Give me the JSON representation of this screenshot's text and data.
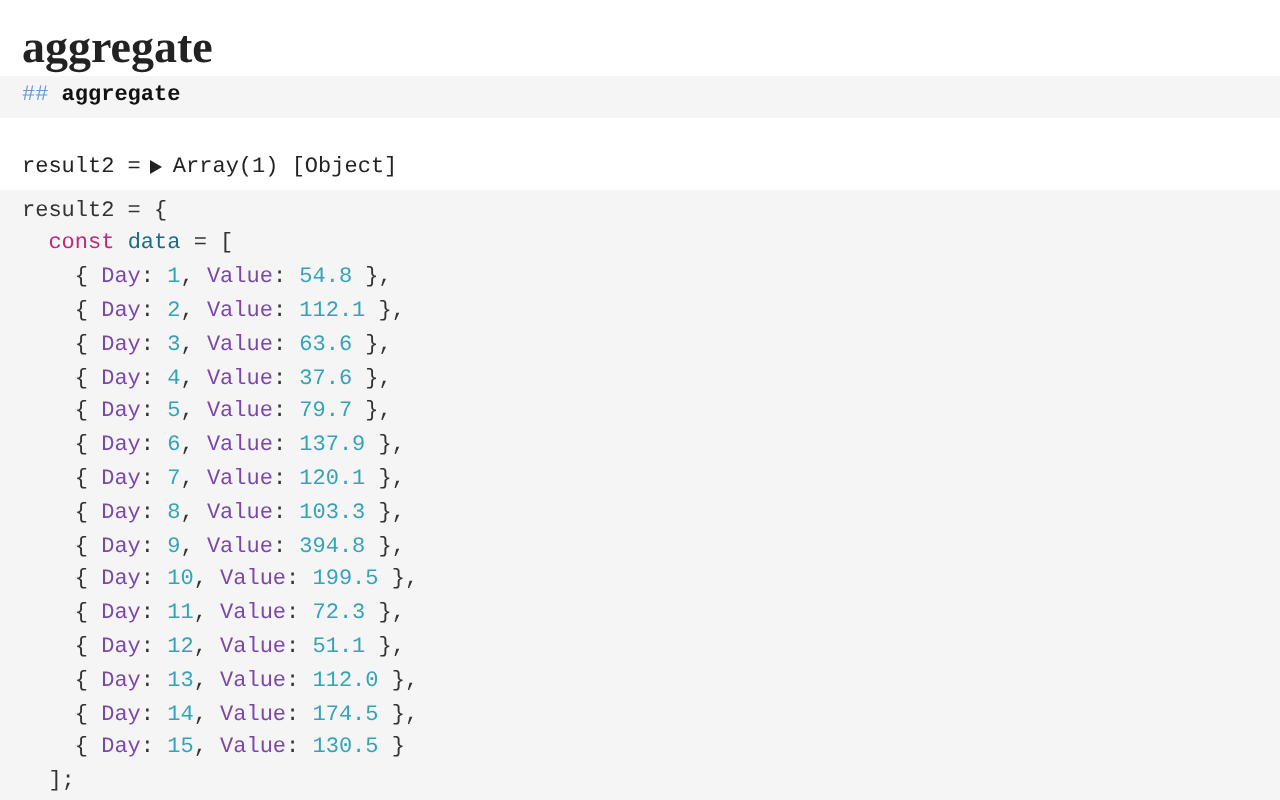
{
  "title": "aggregate",
  "markdown_cell": {
    "marker": "##",
    "text": "aggregate"
  },
  "output": {
    "name": "result2 =",
    "expanded": false,
    "value": "Array(1) [Object]"
  },
  "code": [
    [
      {
        "kind": "plain",
        "text": "result2 = {"
      }
    ],
    [
      {
        "kind": "keyword",
        "text": "  const"
      },
      {
        "kind": "variable",
        "text": " data"
      },
      {
        "kind": "plain",
        "text": " = ["
      }
    ],
    [
      {
        "kind": "plain",
        "text": "    { "
      },
      {
        "kind": "property",
        "text": "Day"
      },
      {
        "kind": "plain",
        "text": ": "
      },
      {
        "kind": "number",
        "text": "1"
      },
      {
        "kind": "plain",
        "text": ", "
      },
      {
        "kind": "property",
        "text": "Value"
      },
      {
        "kind": "plain",
        "text": ": "
      },
      {
        "kind": "number",
        "text": "54.8"
      },
      {
        "kind": "plain",
        "text": " },"
      }
    ],
    [
      {
        "kind": "plain",
        "text": "    { "
      },
      {
        "kind": "property",
        "text": "Day"
      },
      {
        "kind": "plain",
        "text": ": "
      },
      {
        "kind": "number",
        "text": "2"
      },
      {
        "kind": "plain",
        "text": ", "
      },
      {
        "kind": "property",
        "text": "Value"
      },
      {
        "kind": "plain",
        "text": ": "
      },
      {
        "kind": "number",
        "text": "112.1"
      },
      {
        "kind": "plain",
        "text": " },"
      }
    ],
    [
      {
        "kind": "plain",
        "text": "    { "
      },
      {
        "kind": "property",
        "text": "Day"
      },
      {
        "kind": "plain",
        "text": ": "
      },
      {
        "kind": "number",
        "text": "3"
      },
      {
        "kind": "plain",
        "text": ", "
      },
      {
        "kind": "property",
        "text": "Value"
      },
      {
        "kind": "plain",
        "text": ": "
      },
      {
        "kind": "number",
        "text": "63.6"
      },
      {
        "kind": "plain",
        "text": " },"
      }
    ],
    [
      {
        "kind": "plain",
        "text": "    { "
      },
      {
        "kind": "property",
        "text": "Day"
      },
      {
        "kind": "plain",
        "text": ": "
      },
      {
        "kind": "number",
        "text": "4"
      },
      {
        "kind": "plain",
        "text": ", "
      },
      {
        "kind": "property",
        "text": "Value"
      },
      {
        "kind": "plain",
        "text": ": "
      },
      {
        "kind": "number",
        "text": "37.6"
      },
      {
        "kind": "plain",
        "text": " },"
      }
    ],
    [
      {
        "kind": "plain",
        "text": "    { "
      },
      {
        "kind": "property",
        "text": "Day"
      },
      {
        "kind": "plain",
        "text": ": "
      },
      {
        "kind": "number",
        "text": "5"
      },
      {
        "kind": "plain",
        "text": ", "
      },
      {
        "kind": "property",
        "text": "Value"
      },
      {
        "kind": "plain",
        "text": ": "
      },
      {
        "kind": "number",
        "text": "79.7"
      },
      {
        "kind": "plain",
        "text": " },"
      }
    ],
    [
      {
        "kind": "plain",
        "text": "    { "
      },
      {
        "kind": "property",
        "text": "Day"
      },
      {
        "kind": "plain",
        "text": ": "
      },
      {
        "kind": "number",
        "text": "6"
      },
      {
        "kind": "plain",
        "text": ", "
      },
      {
        "kind": "property",
        "text": "Value"
      },
      {
        "kind": "plain",
        "text": ": "
      },
      {
        "kind": "number",
        "text": "137.9"
      },
      {
        "kind": "plain",
        "text": " },"
      }
    ],
    [
      {
        "kind": "plain",
        "text": "    { "
      },
      {
        "kind": "property",
        "text": "Day"
      },
      {
        "kind": "plain",
        "text": ": "
      },
      {
        "kind": "number",
        "text": "7"
      },
      {
        "kind": "plain",
        "text": ", "
      },
      {
        "kind": "property",
        "text": "Value"
      },
      {
        "kind": "plain",
        "text": ": "
      },
      {
        "kind": "number",
        "text": "120.1"
      },
      {
        "kind": "plain",
        "text": " },"
      }
    ],
    [
      {
        "kind": "plain",
        "text": "    { "
      },
      {
        "kind": "property",
        "text": "Day"
      },
      {
        "kind": "plain",
        "text": ": "
      },
      {
        "kind": "number",
        "text": "8"
      },
      {
        "kind": "plain",
        "text": ", "
      },
      {
        "kind": "property",
        "text": "Value"
      },
      {
        "kind": "plain",
        "text": ": "
      },
      {
        "kind": "number",
        "text": "103.3"
      },
      {
        "kind": "plain",
        "text": " },"
      }
    ],
    [
      {
        "kind": "plain",
        "text": "    { "
      },
      {
        "kind": "property",
        "text": "Day"
      },
      {
        "kind": "plain",
        "text": ": "
      },
      {
        "kind": "number",
        "text": "9"
      },
      {
        "kind": "plain",
        "text": ", "
      },
      {
        "kind": "property",
        "text": "Value"
      },
      {
        "kind": "plain",
        "text": ": "
      },
      {
        "kind": "number",
        "text": "394.8"
      },
      {
        "kind": "plain",
        "text": " },"
      }
    ],
    [
      {
        "kind": "plain",
        "text": "    { "
      },
      {
        "kind": "property",
        "text": "Day"
      },
      {
        "kind": "plain",
        "text": ": "
      },
      {
        "kind": "number",
        "text": "10"
      },
      {
        "kind": "plain",
        "text": ", "
      },
      {
        "kind": "property",
        "text": "Value"
      },
      {
        "kind": "plain",
        "text": ": "
      },
      {
        "kind": "number",
        "text": "199.5"
      },
      {
        "kind": "plain",
        "text": " },"
      }
    ],
    [
      {
        "kind": "plain",
        "text": "    { "
      },
      {
        "kind": "property",
        "text": "Day"
      },
      {
        "kind": "plain",
        "text": ": "
      },
      {
        "kind": "number",
        "text": "11"
      },
      {
        "kind": "plain",
        "text": ", "
      },
      {
        "kind": "property",
        "text": "Value"
      },
      {
        "kind": "plain",
        "text": ": "
      },
      {
        "kind": "number",
        "text": "72.3"
      },
      {
        "kind": "plain",
        "text": " },"
      }
    ],
    [
      {
        "kind": "plain",
        "text": "    { "
      },
      {
        "kind": "property",
        "text": "Day"
      },
      {
        "kind": "plain",
        "text": ": "
      },
      {
        "kind": "number",
        "text": "12"
      },
      {
        "kind": "plain",
        "text": ", "
      },
      {
        "kind": "property",
        "text": "Value"
      },
      {
        "kind": "plain",
        "text": ": "
      },
      {
        "kind": "number",
        "text": "51.1"
      },
      {
        "kind": "plain",
        "text": " },"
      }
    ],
    [
      {
        "kind": "plain",
        "text": "    { "
      },
      {
        "kind": "property",
        "text": "Day"
      },
      {
        "kind": "plain",
        "text": ": "
      },
      {
        "kind": "number",
        "text": "13"
      },
      {
        "kind": "plain",
        "text": ", "
      },
      {
        "kind": "property",
        "text": "Value"
      },
      {
        "kind": "plain",
        "text": ": "
      },
      {
        "kind": "number",
        "text": "112.0"
      },
      {
        "kind": "plain",
        "text": " },"
      }
    ],
    [
      {
        "kind": "plain",
        "text": "    { "
      },
      {
        "kind": "property",
        "text": "Day"
      },
      {
        "kind": "plain",
        "text": ": "
      },
      {
        "kind": "number",
        "text": "14"
      },
      {
        "kind": "plain",
        "text": ", "
      },
      {
        "kind": "property",
        "text": "Value"
      },
      {
        "kind": "plain",
        "text": ": "
      },
      {
        "kind": "number",
        "text": "174.5"
      },
      {
        "kind": "plain",
        "text": " },"
      }
    ],
    [
      {
        "kind": "plain",
        "text": "    { "
      },
      {
        "kind": "property",
        "text": "Day"
      },
      {
        "kind": "plain",
        "text": ": "
      },
      {
        "kind": "number",
        "text": "15"
      },
      {
        "kind": "plain",
        "text": ", "
      },
      {
        "kind": "property",
        "text": "Value"
      },
      {
        "kind": "plain",
        "text": ": "
      },
      {
        "kind": "number",
        "text": "130.5"
      },
      {
        "kind": "plain",
        "text": " }"
      }
    ],
    [
      {
        "kind": "plain",
        "text": "  ];"
      }
    ]
  ]
}
